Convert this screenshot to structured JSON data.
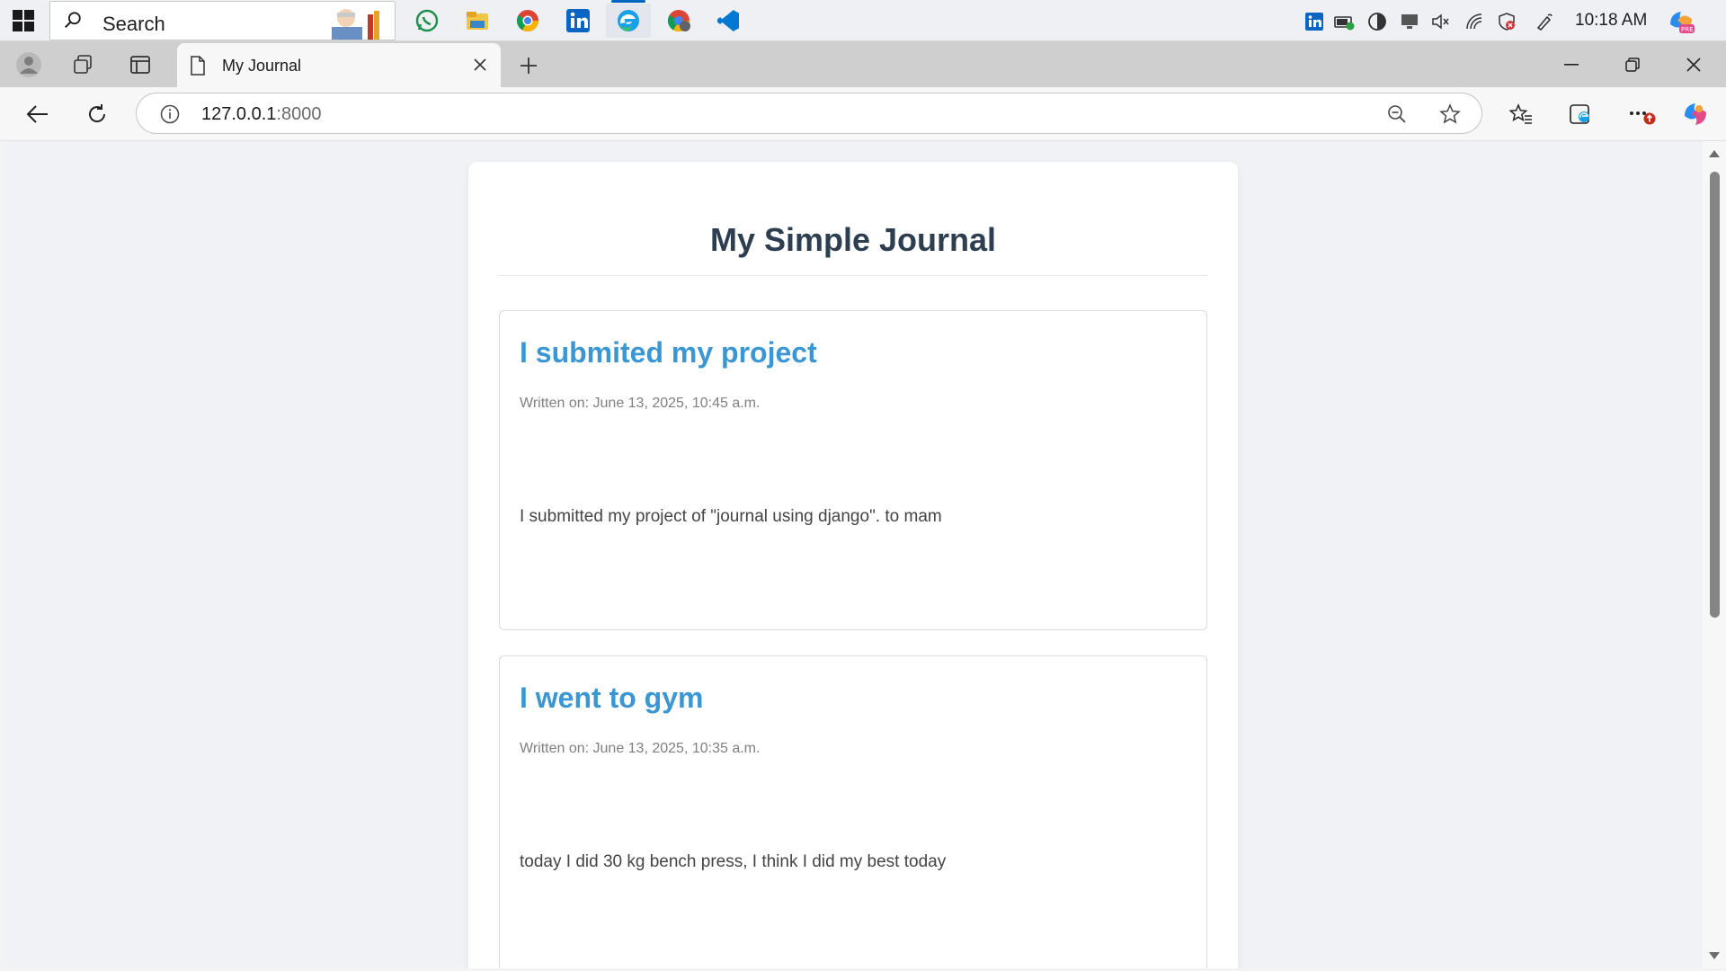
{
  "taskbar": {
    "search_placeholder": "Search",
    "time": "10:18 AM",
    "apps": [
      "whatsapp-icon",
      "file-explorer-icon",
      "chrome-icon",
      "linkedin-icon",
      "edge-icon",
      "chrome-profile-icon",
      "vscode-icon"
    ]
  },
  "browser": {
    "tab_title": "My Journal",
    "url_host": "127.0.0.1",
    "url_port": ":8000"
  },
  "page": {
    "title": "My Simple Journal",
    "entries": [
      {
        "title": "I submited my project",
        "date": "Written on: June 13, 2025, 10:45 a.m.",
        "body": "I submitted my project of \"journal using django\". to mam"
      },
      {
        "title": "I went to gym",
        "date": "Written on: June 13, 2025, 10:35 a.m.",
        "body": "today I did 30 kg bench press, I think I did my best today"
      }
    ]
  },
  "colors": {
    "title": "#2c3e50",
    "entry_title": "#3a97d4",
    "taskbar_accent": "#0067c0"
  }
}
